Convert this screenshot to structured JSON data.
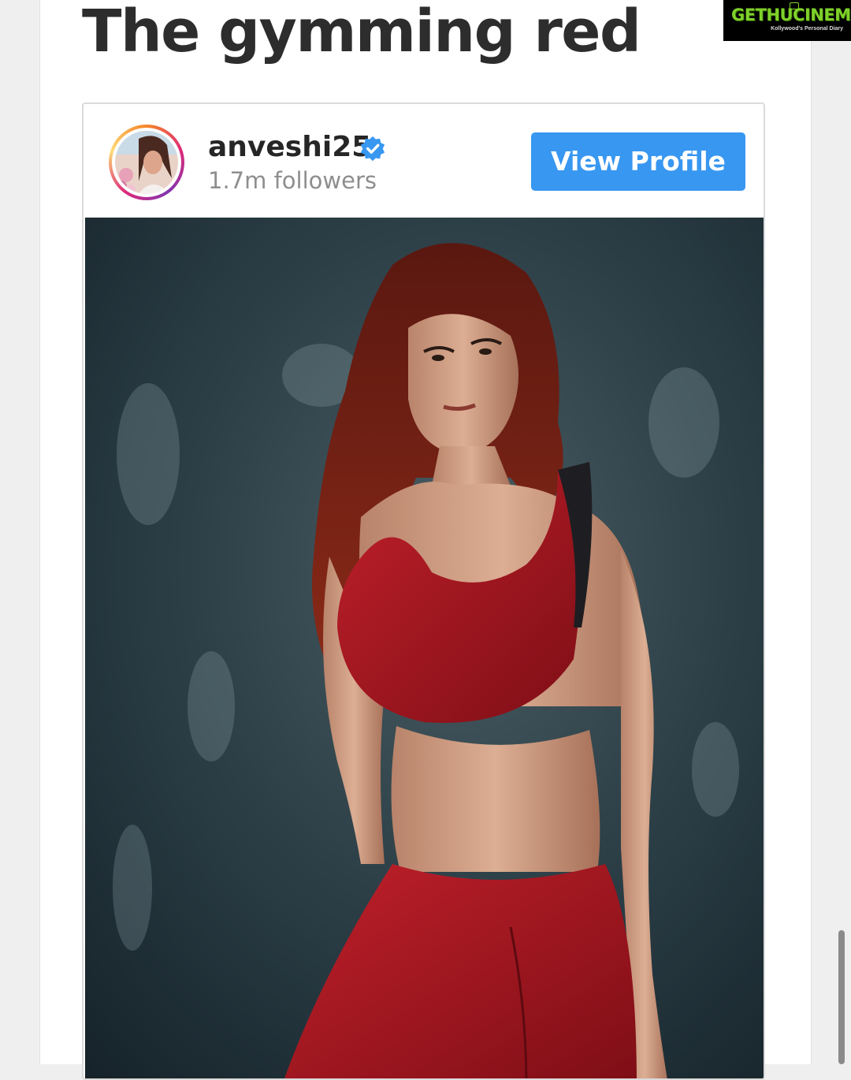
{
  "article": {
    "title": "The gymming red"
  },
  "watermark": {
    "brand": "GETHUCINEMA",
    "tagline": "Kollywood's Personal Diary"
  },
  "embed": {
    "username": "anveshi25",
    "verified": true,
    "followers": "1.7m followers",
    "view_profile_label": "View Profile",
    "button_color": "#3897f0",
    "verified_color": "#3897f0"
  },
  "colors": {
    "title": "#2d2d2d",
    "outfit_red": "#a8141c",
    "backdrop": "#2a3d45"
  }
}
